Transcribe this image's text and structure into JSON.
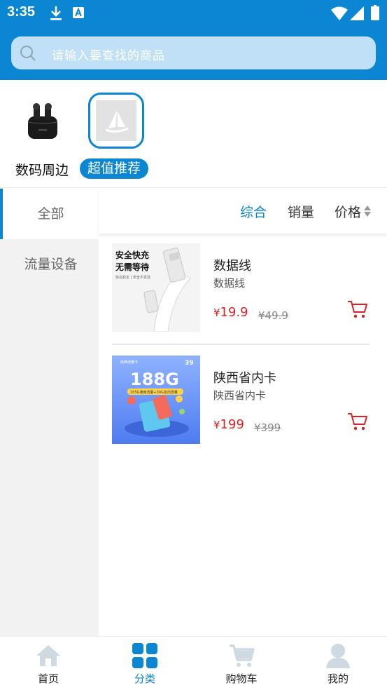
{
  "status_bar": {
    "time": "3:35"
  },
  "search": {
    "placeholder": "请输入要查找的商品"
  },
  "top_categories": [
    {
      "label": "数码周边",
      "icon": "earbuds-icon",
      "selected": false
    },
    {
      "label": "超值推荐",
      "icon": "logo-placeholder-icon",
      "selected": true
    }
  ],
  "sidebar": {
    "items": [
      {
        "label": "全部",
        "active": true
      },
      {
        "label": "流量设备",
        "active": false
      }
    ]
  },
  "sort": {
    "items": [
      {
        "label": "综合",
        "active": true
      },
      {
        "label": "销量",
        "active": false
      },
      {
        "label": "价格",
        "active": false
      }
    ]
  },
  "products": [
    {
      "name": "数据线",
      "subtitle": "数据线",
      "currency": "¥",
      "price": "19.9",
      "old_price": "¥49.9",
      "thumb": {
        "headline1": "安全快充",
        "headline2": "无需等待",
        "caption": "快充稳定 | 安全不发烫"
      }
    },
    {
      "name": "陕西省内卡",
      "subtitle": "陕西省内卡",
      "currency": "¥",
      "price": "199",
      "old_price": "¥399",
      "thumb": {
        "headline": "188G",
        "corner": "39",
        "top_text": "陕西流量卡",
        "band": "155G通用流量+30G定向流量"
      }
    }
  ],
  "tabbar": {
    "items": [
      {
        "label": "首页",
        "icon": "home-icon",
        "active": false
      },
      {
        "label": "分类",
        "icon": "category-grid-icon",
        "active": true
      },
      {
        "label": "购物车",
        "icon": "cart-icon",
        "active": false
      },
      {
        "label": "我的",
        "icon": "user-icon",
        "active": false
      }
    ]
  },
  "colors": {
    "primary": "#0a86d2",
    "price": "#e02020",
    "sidebar_bg": "#f2f2f2"
  }
}
